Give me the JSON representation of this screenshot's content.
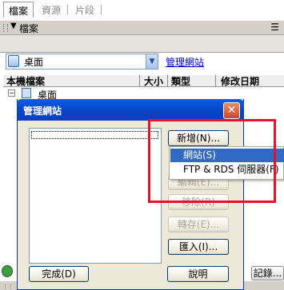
{
  "panel": {
    "title": "檔案",
    "collapse_icon": "triangle-down",
    "menu_icon": "panel-options",
    "tabs": [
      {
        "label": "檔案",
        "active": true
      },
      {
        "label": "資源",
        "active": false
      },
      {
        "label": "片段",
        "active": false
      }
    ],
    "site_select": {
      "value": "桌面"
    },
    "manage_sites_link": "管理網站",
    "columns": [
      "本機檔案",
      "大小",
      "類型",
      "修改日期"
    ],
    "tree": [
      {
        "label": "桌面",
        "expanded": true
      }
    ],
    "log_button": "記錄..."
  },
  "dialog": {
    "title": "管理網站",
    "buttons": {
      "new": "新增(N)...",
      "edit": "編輯(E)...",
      "remove": "移除(R)",
      "export": "轉存(E)...",
      "import": "匯入(I)...",
      "done": "完成(D)",
      "help": "說明"
    },
    "disabled": [
      "edit",
      "remove",
      "export"
    ]
  },
  "popup_menu": {
    "items": [
      {
        "label": "網站(S)",
        "highlighted": true
      },
      {
        "label": "FTP & RDS 伺服器(F)",
        "highlighted": false
      }
    ]
  },
  "colors": {
    "titlebar": "#0a5fe8",
    "highlight_box": "#e8112d",
    "menu_selection": "#316ac5",
    "link": "#0000cc"
  }
}
